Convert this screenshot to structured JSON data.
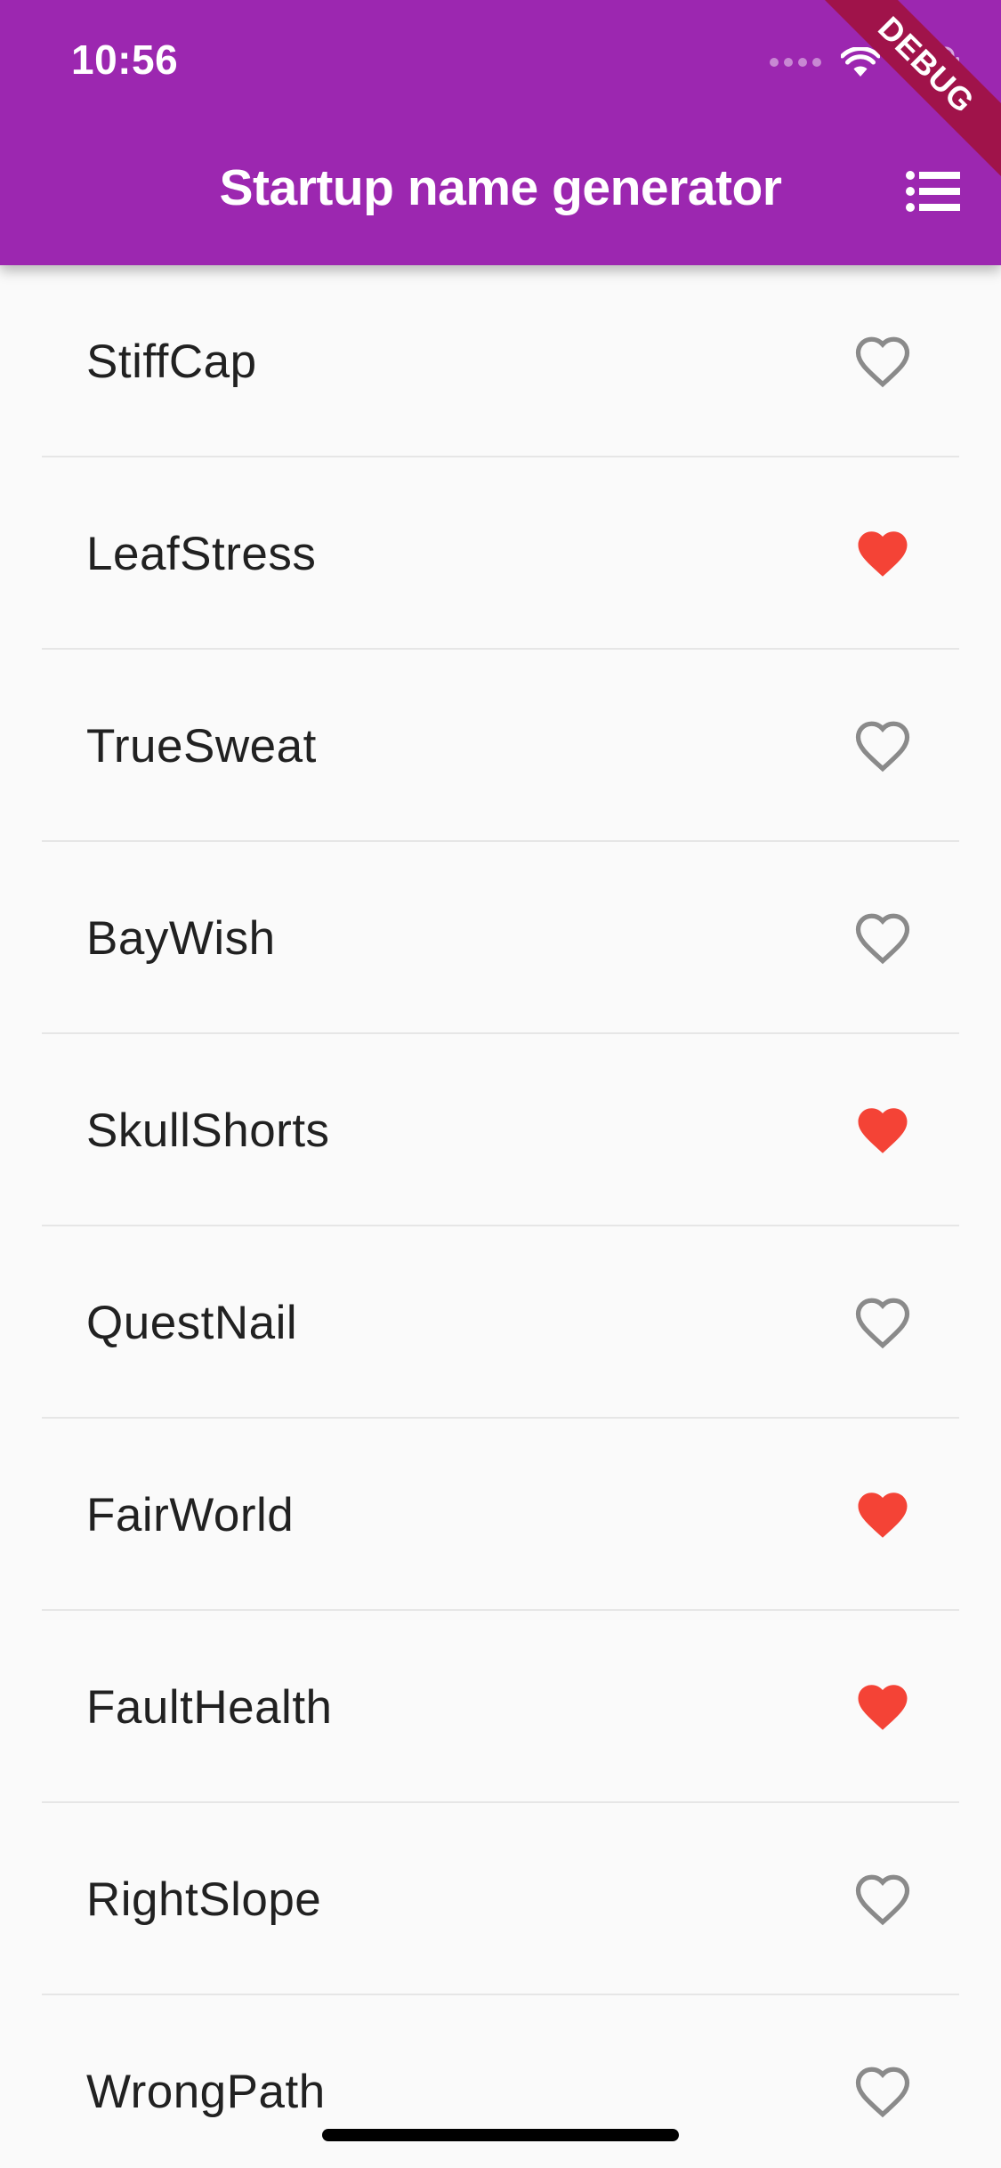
{
  "status_bar": {
    "time": "10:56"
  },
  "app_bar": {
    "title": "Startup name generator",
    "list_icon": "list-icon"
  },
  "debug_banner": {
    "text": "DEBUG"
  },
  "colors": {
    "primary": "#9c27b0",
    "favorite": "#f44336",
    "unfavorite": "#8a8a8a"
  },
  "suggestions": [
    {
      "name": "StiffCap",
      "favorited": false
    },
    {
      "name": "LeafStress",
      "favorited": true
    },
    {
      "name": "TrueSweat",
      "favorited": false
    },
    {
      "name": "BayWish",
      "favorited": false
    },
    {
      "name": "SkullShorts",
      "favorited": true
    },
    {
      "name": "QuestNail",
      "favorited": false
    },
    {
      "name": "FairWorld",
      "favorited": true
    },
    {
      "name": "FaultHealth",
      "favorited": true
    },
    {
      "name": "RightSlope",
      "favorited": false
    },
    {
      "name": "WrongPath",
      "favorited": false
    }
  ]
}
